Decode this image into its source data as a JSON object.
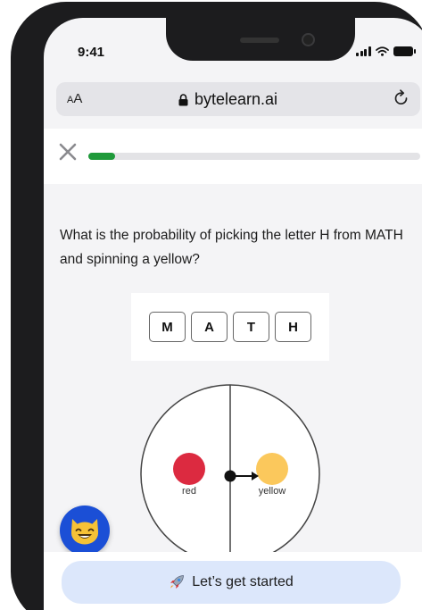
{
  "status": {
    "time": "9:41"
  },
  "browser": {
    "aa_small": "A",
    "aa_large": "A",
    "url": "bytelearn.ai"
  },
  "progress": {
    "fraction": 0.08
  },
  "question": {
    "text": "What is the probability of picking the letter H from MATH and spinning a yellow?"
  },
  "letters": [
    "M",
    "A",
    "T",
    "H"
  ],
  "spinner": {
    "sections": [
      {
        "label": "red",
        "color": "#dc2a40"
      },
      {
        "label": "yellow",
        "color": "#fbc85c"
      }
    ]
  },
  "cta": {
    "label": "Let’s get started",
    "icon": "rocket-icon"
  },
  "avatar": {
    "icon": "cat-emoji-icon"
  },
  "colors": {
    "accent_green": "#1f9a3a",
    "button_bg": "#dce7fb",
    "avatar_bg": "#1b4fd6"
  }
}
